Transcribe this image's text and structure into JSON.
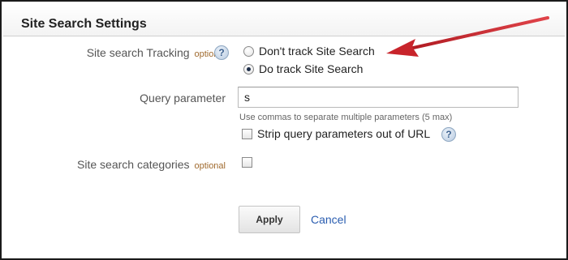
{
  "section": {
    "title": "Site Search Settings"
  },
  "tracking": {
    "label": "Site search Tracking",
    "optional": "optional",
    "help": "?",
    "options": [
      {
        "label": "Don't track Site Search",
        "selected": false
      },
      {
        "label": "Do track Site Search",
        "selected": true
      }
    ]
  },
  "query": {
    "label": "Query parameter",
    "value": "s",
    "hint": "Use commas to separate multiple parameters (5 max)",
    "strip_label": "Strip query parameters out of URL",
    "strip_checked": false,
    "help": "?"
  },
  "categories": {
    "label": "Site search categories",
    "optional": "optional",
    "checked": false
  },
  "actions": {
    "apply": "Apply",
    "cancel": "Cancel"
  },
  "colors": {
    "arrow": "#c8242b",
    "link": "#2a5db0",
    "optional": "#a06a2e"
  },
  "icons": {
    "help": "help-icon",
    "arrow": "red-arrow-annotation"
  }
}
